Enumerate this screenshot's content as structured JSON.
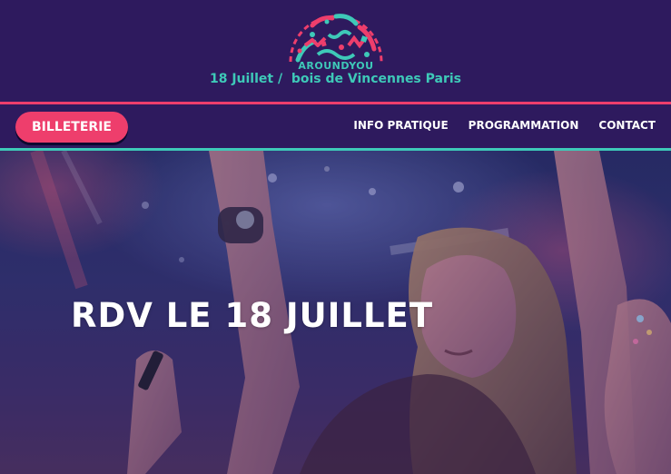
{
  "header": {
    "logo_text": "AROUNDYOU",
    "tagline": "18 Juillet /  bois de Vincennes Paris"
  },
  "nav": {
    "ticket_button": "BILLETERIE",
    "links": [
      {
        "label": "INFO PRATIQUE"
      },
      {
        "label": "PROGRAMMATION"
      },
      {
        "label": "CONTACT"
      }
    ]
  },
  "hero": {
    "title": "RDV LE 18 JUILLET",
    "image_icon": "concert-crowd-photo"
  },
  "colors": {
    "background": "#2e1a5e",
    "accent_pink": "#ee3e6c",
    "accent_teal": "#3ec9b8",
    "text": "#ffffff"
  }
}
